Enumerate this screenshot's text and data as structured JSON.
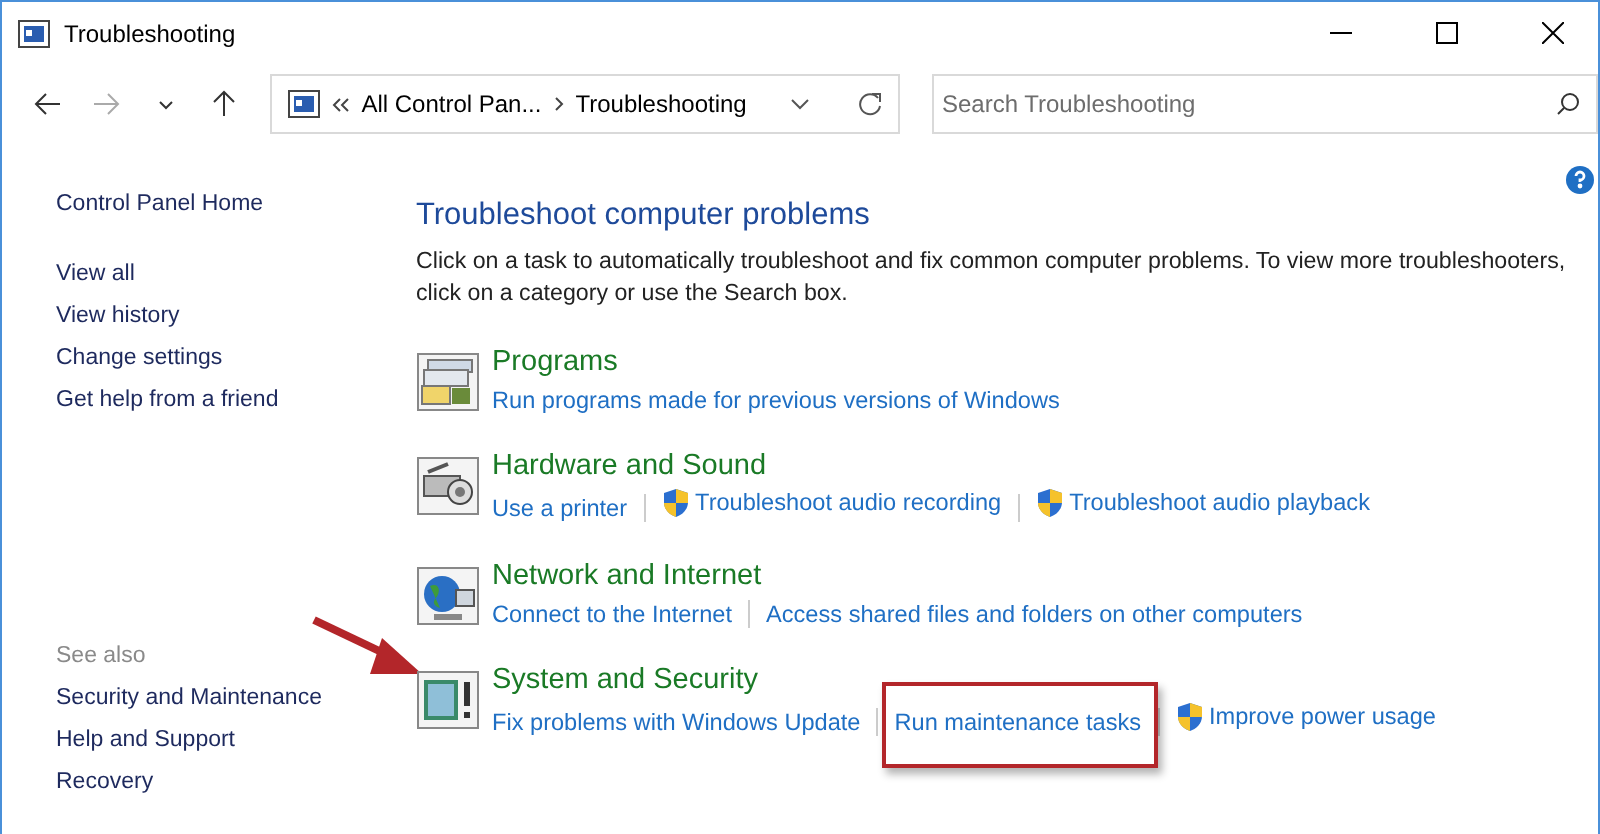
{
  "window": {
    "title": "Troubleshooting"
  },
  "annotations": [
    {
      "kind": "arrow"
    }
  ],
  "address": {
    "crumbs": [
      "All Control Pan...",
      "Troubleshooting"
    ]
  },
  "search": {
    "placeholder": "Search Troubleshooting"
  },
  "sidebar": {
    "items": [
      "Control Panel Home",
      "View all",
      "View history",
      "Change settings",
      "Get help from a friend"
    ],
    "see_also": {
      "heading": "See also",
      "items": [
        "Security and Maintenance",
        "Help and Support",
        "Recovery"
      ]
    }
  },
  "main": {
    "heading": "Troubleshoot computer problems",
    "description": "Click on a task to automatically troubleshoot and fix common computer problems. To view more troubleshooters, click on a category or use the Search box.",
    "categories": [
      {
        "kind": "programs",
        "title": "Programs",
        "tasks": [
          {
            "label": "Run programs made for previous versions of Windows",
            "shield": false,
            "highlighted": false
          }
        ]
      },
      {
        "kind": "hardware",
        "title": "Hardware and Sound",
        "tasks": [
          {
            "label": "Use a printer",
            "shield": false,
            "highlighted": false
          },
          {
            "label": "Troubleshoot audio recording",
            "shield": true,
            "highlighted": false
          },
          {
            "label": "Troubleshoot audio playback",
            "shield": true,
            "highlighted": false
          }
        ]
      },
      {
        "kind": "network",
        "title": "Network and Internet",
        "tasks": [
          {
            "label": "Connect to the Internet",
            "shield": false,
            "highlighted": false
          },
          {
            "label": "Access shared files and folders on other computers",
            "shield": false,
            "highlighted": false
          }
        ]
      },
      {
        "kind": "system",
        "title": "System and Security",
        "tasks": [
          {
            "label": "Fix problems with Windows Update",
            "shield": false,
            "highlighted": false
          },
          {
            "label": "Run maintenance tasks",
            "shield": false,
            "highlighted": true
          },
          {
            "label": "Improve power usage",
            "shield": true,
            "highlighted": false
          }
        ]
      }
    ]
  }
}
